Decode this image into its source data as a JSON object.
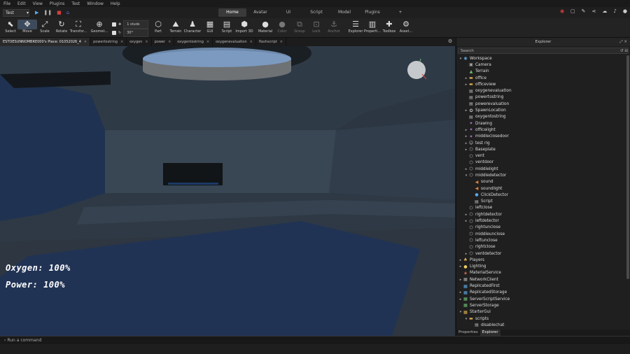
{
  "menu": [
    "File",
    "Edit",
    "View",
    "Plugins",
    "Test",
    "Window",
    "Help"
  ],
  "place_select": "Test",
  "top_tabs": [
    "Home",
    "Avatar",
    "UI",
    "Script",
    "Model",
    "Plugins"
  ],
  "active_top_tab": "Home",
  "add_tab": "+",
  "tools": {
    "select": "Select",
    "move": "Move",
    "scale": "Scale",
    "rotate": "Rotate",
    "transform": "Transfor...",
    "geometry": "Geomet...",
    "part": "Part",
    "terrain": "Terrain",
    "character": "Character",
    "gui": "GUI",
    "script": "Script",
    "import3d": "Import 3D",
    "material": "Material",
    "color": "Color",
    "group": "Group",
    "lock": "Lock",
    "anchor": "Anchor",
    "explorer": "Explorer",
    "properties": "Properti...",
    "toolbox": "Toolbox",
    "assets": "Asset..."
  },
  "stud": {
    "move_value": "1 studs",
    "rotate_value": "30°"
  },
  "doc_tabs": [
    {
      "label": "ESTOESUNNOMBRE000's Place: 01052026_4",
      "active": true
    },
    {
      "label": "powertostring"
    },
    {
      "label": "oxygen"
    },
    {
      "label": "power"
    },
    {
      "label": "oxygentostring"
    },
    {
      "label": "oxygenevaluation"
    },
    {
      "label": "flashscript"
    }
  ],
  "close_glyph": "×",
  "hud": {
    "oxygen": "Oxygen: 100%",
    "power": "Power: 100%"
  },
  "explorer": {
    "title": "Explorer",
    "search_placeholder": "Search",
    "items": [
      {
        "label": "Workspace",
        "depth": 0,
        "arrow": "▾",
        "icon": "◉",
        "color": "#5aa9e6"
      },
      {
        "label": "Camera",
        "depth": 1,
        "arrow": "",
        "icon": "▣",
        "color": "#aaa"
      },
      {
        "label": "Terrain",
        "depth": 1,
        "arrow": "",
        "icon": "▲",
        "color": "#6fbf73"
      },
      {
        "label": "office",
        "depth": 1,
        "arrow": "▸",
        "icon": "▬",
        "color": "#e0b050"
      },
      {
        "label": "officeview",
        "depth": 1,
        "arrow": "▸",
        "icon": "▬",
        "color": "#e0b050"
      },
      {
        "label": "oxygenevaluation",
        "depth": 1,
        "arrow": "",
        "icon": "▤",
        "color": "#bbb"
      },
      {
        "label": "powertostring",
        "depth": 1,
        "arrow": "",
        "icon": "▤",
        "color": "#bbb"
      },
      {
        "label": "powerevaluation",
        "depth": 1,
        "arrow": "",
        "icon": "▤",
        "color": "#bbb"
      },
      {
        "label": "SpawnLocation",
        "depth": 1,
        "arrow": "▸",
        "icon": "✪",
        "color": "#ccc"
      },
      {
        "label": "oxygentostring",
        "depth": 1,
        "arrow": "",
        "icon": "▤",
        "color": "#bbb"
      },
      {
        "label": "Drawing",
        "depth": 1,
        "arrow": "",
        "icon": "✦",
        "color": "#c27ad6"
      },
      {
        "label": "officelight",
        "depth": 1,
        "arrow": "▸",
        "icon": "✦",
        "color": "#c27ad6"
      },
      {
        "label": "middleclosedoor",
        "depth": 1,
        "arrow": "▸",
        "icon": "✦",
        "color": "#c27ad6"
      },
      {
        "label": "test rig",
        "depth": 1,
        "arrow": "▸",
        "icon": "☺",
        "color": "#ccc"
      },
      {
        "label": "Baseplate",
        "depth": 1,
        "arrow": "▸",
        "icon": "⬡",
        "color": "#ccc"
      },
      {
        "label": "vent",
        "depth": 1,
        "arrow": "",
        "icon": "⬡",
        "color": "#ccc"
      },
      {
        "label": "ventdoor",
        "depth": 1,
        "arrow": "",
        "icon": "⬡",
        "color": "#ccc"
      },
      {
        "label": "middlelight",
        "depth": 1,
        "arrow": "▸",
        "icon": "⬡",
        "color": "#ccc"
      },
      {
        "label": "middledetector",
        "depth": 1,
        "arrow": "▾",
        "icon": "⬡",
        "color": "#ccc"
      },
      {
        "label": "sound",
        "depth": 2,
        "arrow": "",
        "icon": "◀",
        "color": "#e08040"
      },
      {
        "label": "soundlight",
        "depth": 2,
        "arrow": "",
        "icon": "◀",
        "color": "#e08040"
      },
      {
        "label": "ClickDetector",
        "depth": 2,
        "arrow": "",
        "icon": "●",
        "color": "#5aa9e6"
      },
      {
        "label": "Script",
        "depth": 2,
        "arrow": "",
        "icon": "▤",
        "color": "#bbb"
      },
      {
        "label": "leftclose",
        "depth": 1,
        "arrow": "",
        "icon": "⬡",
        "color": "#ccc"
      },
      {
        "label": "rightdetector",
        "depth": 1,
        "arrow": "▸",
        "icon": "⬡",
        "color": "#ccc"
      },
      {
        "label": "leftdetector",
        "depth": 1,
        "arrow": "▸",
        "icon": "⬡",
        "color": "#ccc"
      },
      {
        "label": "rightunclose",
        "depth": 1,
        "arrow": "",
        "icon": "⬡",
        "color": "#ccc"
      },
      {
        "label": "middleunclose",
        "depth": 1,
        "arrow": "",
        "icon": "⬡",
        "color": "#ccc"
      },
      {
        "label": "leftunclose",
        "depth": 1,
        "arrow": "",
        "icon": "⬡",
        "color": "#ccc"
      },
      {
        "label": "rightclose",
        "depth": 1,
        "arrow": "",
        "icon": "⬡",
        "color": "#ccc"
      },
      {
        "label": "ventdetector",
        "depth": 1,
        "arrow": "▸",
        "icon": "⬡",
        "color": "#ccc"
      },
      {
        "label": "Players",
        "depth": 0,
        "arrow": "▸",
        "icon": "♣",
        "color": "#e0b050"
      },
      {
        "label": "Lighting",
        "depth": 0,
        "arrow": "▸",
        "icon": "●",
        "color": "#f0d060"
      },
      {
        "label": "MaterialService",
        "depth": 0,
        "arrow": "",
        "icon": "◈",
        "color": "#d07050"
      },
      {
        "label": "NetworkClient",
        "depth": 0,
        "arrow": "▸",
        "icon": "▦",
        "color": "#aaa"
      },
      {
        "label": "ReplicatedFirst",
        "depth": 0,
        "arrow": "",
        "icon": "▦",
        "color": "#5aa9e6"
      },
      {
        "label": "ReplicatedStorage",
        "depth": 0,
        "arrow": "▸",
        "icon": "▦",
        "color": "#5aa9e6"
      },
      {
        "label": "ServerScriptService",
        "depth": 0,
        "arrow": "▸",
        "icon": "▦",
        "color": "#6fbf73"
      },
      {
        "label": "ServerStorage",
        "depth": 0,
        "arrow": "",
        "icon": "▦",
        "color": "#6fbf73"
      },
      {
        "label": "StarterGui",
        "depth": 0,
        "arrow": "▾",
        "icon": "▦",
        "color": "#e0b050"
      },
      {
        "label": "scripts",
        "depth": 1,
        "arrow": "▾",
        "icon": "▬",
        "color": "#e0b050"
      },
      {
        "label": "disablechat",
        "depth": 2,
        "arrow": "",
        "icon": "▤",
        "color": "#bbb"
      }
    ]
  },
  "explorer_tabs": [
    "Properties",
    "Explorer"
  ],
  "active_explorer_tab": "Explorer",
  "command_placeholder": "Run a command"
}
